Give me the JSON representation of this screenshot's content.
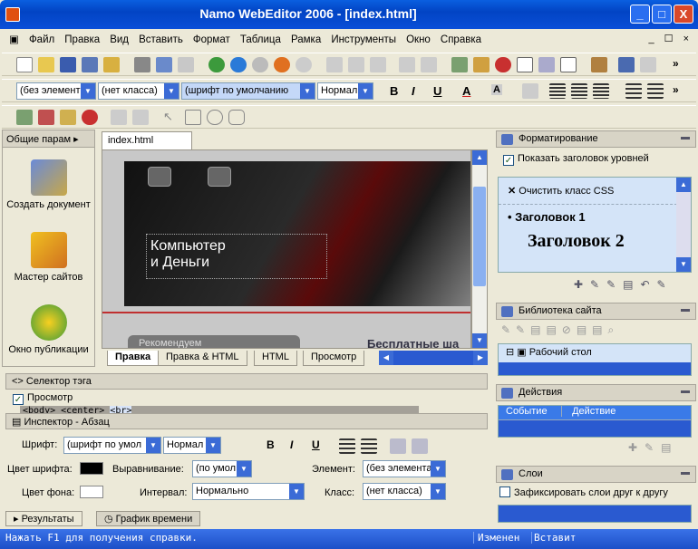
{
  "window": {
    "title": "Namo WebEditor 2006 - [index.html]",
    "min": "_",
    "max": "□",
    "close": "X"
  },
  "menu": [
    "Файл",
    "Правка",
    "Вид",
    "Вставить",
    "Формат",
    "Таблица",
    "Рамка",
    "Инструменты",
    "Окно",
    "Справка"
  ],
  "mdi_controls": "_ ☐ ×",
  "format_bar": {
    "style": "(без элемент",
    "class": "(нет класса)",
    "font": "(шрифт по умолчанию",
    "size": "Нормал",
    "bold": "B",
    "italic": "I",
    "underline": "U",
    "font_color": "A",
    "highlight": "A"
  },
  "left_panel": {
    "header": "Общие парам",
    "items": [
      "Создать документ",
      "Мастер сайтов",
      "Окно публикации"
    ]
  },
  "document_tab": "index.html",
  "page_content": {
    "heading_line1": "Компьютер",
    "heading_line2": "и Деньги",
    "partial_text": "Бесплатные ша",
    "partial_btn": "Рекомендуем"
  },
  "view_tabs": [
    "Правка",
    "Правка & HTML",
    "HTML",
    "Просмотр"
  ],
  "tag_selector": {
    "title": "Селектор тэга",
    "checkbox_label": "Просмотр",
    "tags": [
      "<body>",
      "<center>",
      "<br>"
    ]
  },
  "inspector": {
    "title": "Инспектор - Абзац",
    "font_label": "Шрифт:",
    "font_value": "(шрифт по умол",
    "size_value": "Нормал",
    "font_color_label": "Цвет шрифта:",
    "bg_color_label": "Цвет фона:",
    "align_label": "Выравнивание:",
    "align_value": "(по умол",
    "interval_label": "Интервал:",
    "interval_value": "Нормально",
    "element_label": "Элемент:",
    "element_value": "(без элемента",
    "class_label": "Класс:",
    "class_value": "(нет класса)",
    "bold": "B",
    "italic": "I",
    "underline": "U"
  },
  "bottom_tabs": [
    "Результаты",
    "График времени"
  ],
  "right_panel": {
    "formatting": {
      "title": "Форматирование",
      "show_heading_label": "Показать заголовок уровней",
      "clear_css": "Очистить класс CSS",
      "h1": "Заголовок 1",
      "h2": "Заголовок 2"
    },
    "site_library": {
      "title": "Библиотека сайта",
      "tree_item": "Рабочий стол"
    },
    "actions": {
      "title": "Действия",
      "col_event": "Событие",
      "col_action": "Действие"
    },
    "layers": {
      "title": "Слои",
      "lock_label": "Зафиксировать слои друг к другу"
    }
  },
  "status": {
    "help": "Нажать F1 для получения справки.",
    "modified": "Изменен",
    "insert": "Вставит"
  },
  "colors": {
    "title_bar": "#0244c4",
    "status_bar": "#1c4fc8",
    "panel_bg": "#ece9d8"
  }
}
